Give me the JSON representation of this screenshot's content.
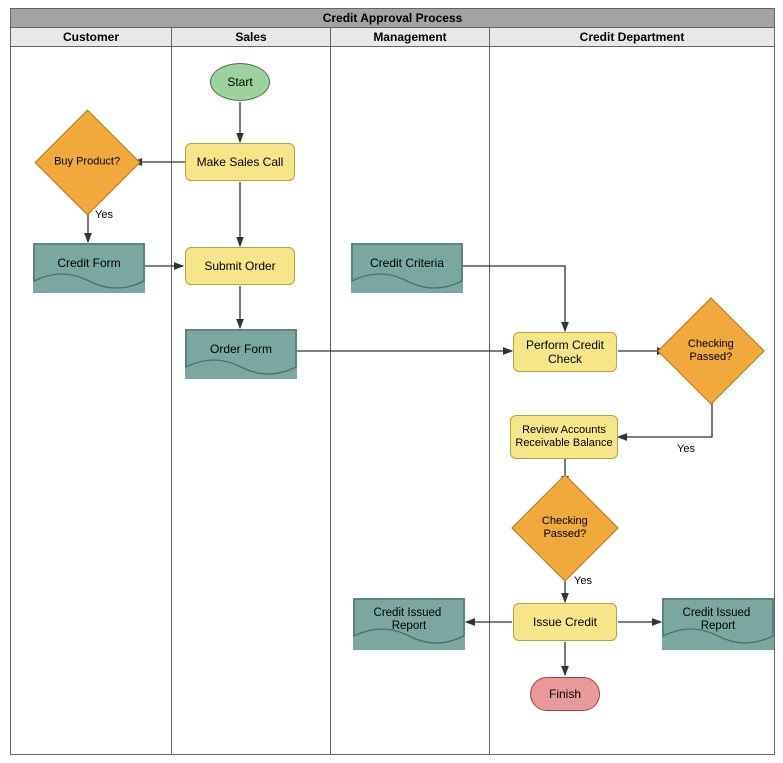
{
  "title": "Credit Approval Process",
  "lanes": {
    "customer": "Customer",
    "sales": "Sales",
    "management": "Management",
    "credit": "Credit Department"
  },
  "nodes": {
    "start": "Start",
    "finish": "Finish",
    "buy_product": "Buy Product?",
    "credit_form": "Credit Form",
    "make_sales_call": "Make Sales Call",
    "submit_order": "Submit Order",
    "order_form": "Order Form",
    "credit_criteria": "Credit Criteria",
    "perform_credit_check": "Perform Credit Check",
    "checking_passed_1": "Checking Passed?",
    "review_ar": "Review Accounts Receivable Balance",
    "checking_passed_2": "Checking Passed?",
    "issue_credit": "Issue Credit",
    "credit_issued_report_left": "Credit Issued Report",
    "credit_issued_report_right": "Credit Issued Report"
  },
  "edge_labels": {
    "yes1": "Yes",
    "yes2": "Yes",
    "yes3": "Yes"
  },
  "chart_data": {
    "type": "swimlane-flowchart",
    "title": "Credit Approval Process",
    "lanes": [
      "Customer",
      "Sales",
      "Management",
      "Credit Department"
    ],
    "nodes": [
      {
        "id": "start",
        "lane": "Sales",
        "type": "terminator",
        "label": "Start"
      },
      {
        "id": "make_sales_call",
        "lane": "Sales",
        "type": "process",
        "label": "Make Sales Call"
      },
      {
        "id": "buy_product",
        "lane": "Customer",
        "type": "decision",
        "label": "Buy Product?"
      },
      {
        "id": "credit_form",
        "lane": "Customer",
        "type": "document",
        "label": "Credit Form"
      },
      {
        "id": "submit_order",
        "lane": "Sales",
        "type": "process",
        "label": "Submit Order"
      },
      {
        "id": "order_form",
        "lane": "Sales",
        "type": "document",
        "label": "Order Form"
      },
      {
        "id": "credit_criteria",
        "lane": "Management",
        "type": "document",
        "label": "Credit Criteria"
      },
      {
        "id": "perform_credit_check",
        "lane": "Credit Department",
        "type": "process",
        "label": "Perform Credit Check"
      },
      {
        "id": "checking_passed_1",
        "lane": "Credit Department",
        "type": "decision",
        "label": "Checking Passed?"
      },
      {
        "id": "review_ar",
        "lane": "Credit Department",
        "type": "process",
        "label": "Review Accounts Receivable Balance"
      },
      {
        "id": "checking_passed_2",
        "lane": "Credit Department",
        "type": "decision",
        "label": "Checking Passed?"
      },
      {
        "id": "issue_credit",
        "lane": "Credit Department",
        "type": "process",
        "label": "Issue Credit"
      },
      {
        "id": "credit_issued_report_left",
        "lane": "Management",
        "type": "document",
        "label": "Credit Issued Report"
      },
      {
        "id": "credit_issued_report_right",
        "lane": "Credit Department",
        "type": "document",
        "label": "Credit Issued Report"
      },
      {
        "id": "finish",
        "lane": "Credit Department",
        "type": "terminator",
        "label": "Finish"
      }
    ],
    "edges": [
      {
        "from": "start",
        "to": "make_sales_call"
      },
      {
        "from": "make_sales_call",
        "to": "buy_product"
      },
      {
        "from": "buy_product",
        "to": "credit_form",
        "label": "Yes"
      },
      {
        "from": "credit_form",
        "to": "submit_order"
      },
      {
        "from": "make_sales_call",
        "to": "submit_order"
      },
      {
        "from": "submit_order",
        "to": "order_form"
      },
      {
        "from": "order_form",
        "to": "perform_credit_check"
      },
      {
        "from": "credit_criteria",
        "to": "perform_credit_check"
      },
      {
        "from": "perform_credit_check",
        "to": "checking_passed_1"
      },
      {
        "from": "checking_passed_1",
        "to": "review_ar",
        "label": "Yes"
      },
      {
        "from": "review_ar",
        "to": "checking_passed_2"
      },
      {
        "from": "checking_passed_2",
        "to": "issue_credit",
        "label": "Yes"
      },
      {
        "from": "issue_credit",
        "to": "credit_issued_report_left"
      },
      {
        "from": "issue_credit",
        "to": "credit_issued_report_right"
      },
      {
        "from": "issue_credit",
        "to": "finish"
      }
    ]
  }
}
